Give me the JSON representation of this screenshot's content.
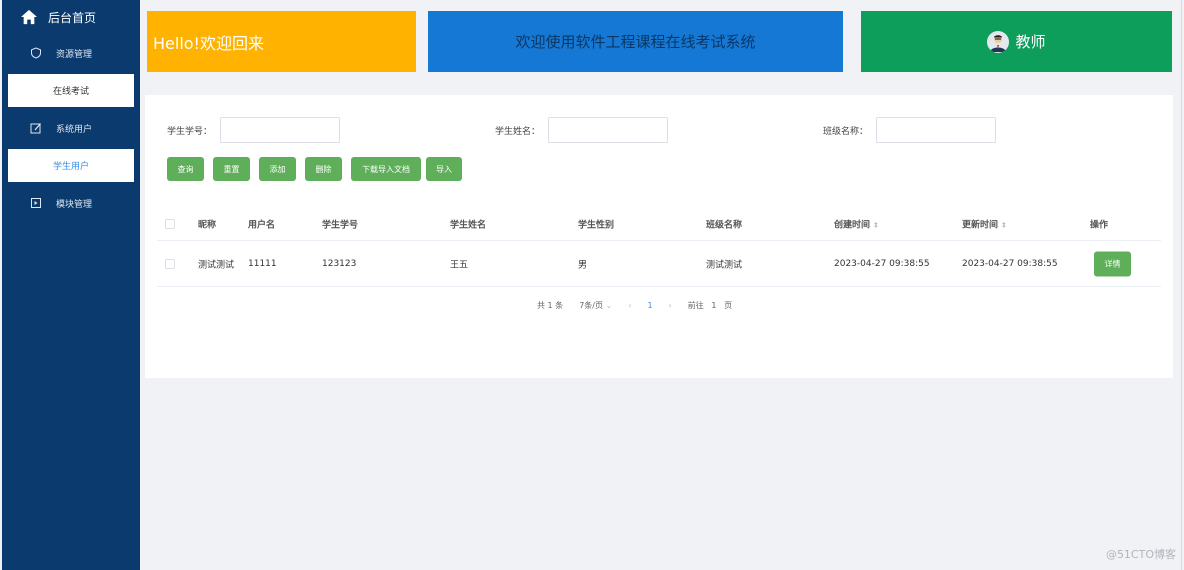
{
  "sidebar": {
    "brand": "后台首页",
    "items": [
      {
        "label": "资源管理",
        "icon": "shield-icon"
      },
      {
        "label": "在线考试",
        "sub": true,
        "active": false
      },
      {
        "label": "系统用户",
        "icon": "edit-icon"
      },
      {
        "label": "学生用户",
        "sub": true,
        "active": true
      },
      {
        "label": "模块管理",
        "icon": "module-icon"
      }
    ]
  },
  "cards": {
    "welcome": "Hello!欢迎回来",
    "system": "欢迎使用软件工程课程在线考试系统",
    "role": "教师"
  },
  "filters": {
    "student_no": "学生学号：",
    "student_name": "学生姓名：",
    "class_name": "班级名称："
  },
  "actions": {
    "query": "查询",
    "reset": "重置",
    "add": "添加",
    "delete": "删除",
    "download": "下载导入文档",
    "import": "导入"
  },
  "table": {
    "headers": [
      "昵称",
      "用户名",
      "学生学号",
      "学生姓名",
      "学生性别",
      "班级名称",
      "创建时间",
      "更新时间",
      "操作"
    ],
    "rows": [
      [
        "测试测试",
        "11111",
        "123123",
        "王五",
        "男",
        "测试测试",
        "2023-04-27 09:38:55",
        "2023-04-27 09:38:55",
        "详情"
      ]
    ]
  },
  "pagination": {
    "total": "共 1 条",
    "page_size": "7条/页",
    "prev": "‹",
    "current": "1",
    "next": "›",
    "goto": "前往",
    "goto_value": "1",
    "page_suffix": "页"
  },
  "watermark": "@51CTO博客",
  "colors": {
    "sidebar": "#0b3a6e",
    "card_yellow": "#ffb300",
    "card_blue": "#1578d4",
    "card_green": "#0e9e5c",
    "button_green": "#5fae5a"
  }
}
